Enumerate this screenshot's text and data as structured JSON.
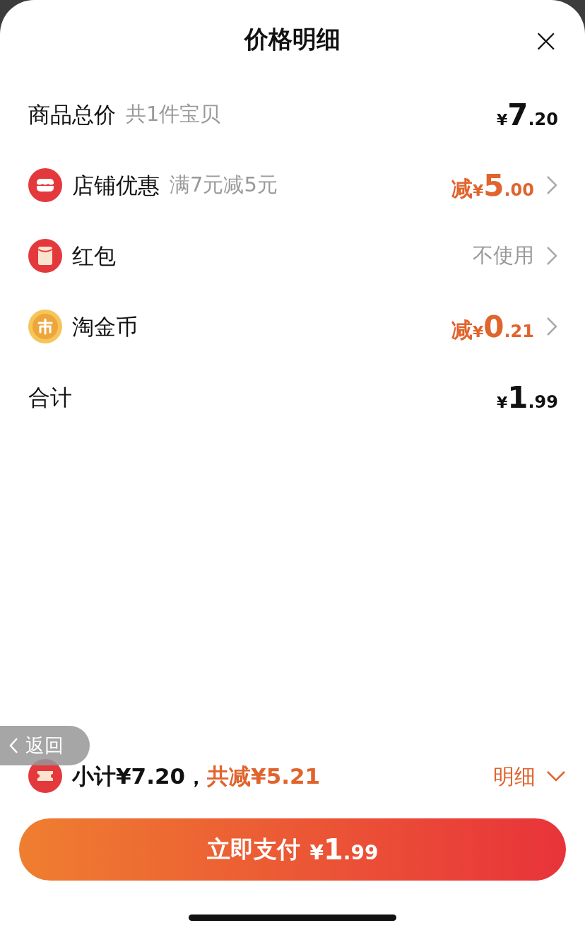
{
  "sheet": {
    "title": "价格明细",
    "close": "×"
  },
  "rows": [
    {
      "label": "商品总价",
      "note": "共1件宝贝",
      "kind": "total",
      "amount": {
        "currency": "¥",
        "whole": "7",
        "fraction": ".20"
      },
      "arrow": false
    },
    {
      "label": "店铺优惠",
      "note": "满7元减5元",
      "kind": "discount",
      "amount": {
        "prefix": "减",
        "currency": "¥",
        "whole": "5",
        "fraction": ".00"
      },
      "arrow": true
    },
    {
      "label": "红包",
      "kind": "option",
      "value": "不使用",
      "arrow": true
    },
    {
      "label": "淘金币",
      "kind": "discount",
      "amount": {
        "prefix": "减",
        "currency": "¥",
        "whole": "0",
        "fraction": ".21"
      },
      "arrow": true
    },
    {
      "label": "合计",
      "kind": "total",
      "amount": {
        "currency": "¥",
        "whole": "1",
        "fraction": ".99"
      },
      "arrow": false
    }
  ],
  "back_pill": {
    "label": "返回"
  },
  "summary": {
    "subtotal": "小计¥7.20，",
    "saving": "共减¥5.21",
    "details": "明细",
    "expanded": true
  },
  "pay_button": {
    "label": "立即支付",
    "currency": "¥",
    "whole": "1",
    "fraction": ".99"
  }
}
